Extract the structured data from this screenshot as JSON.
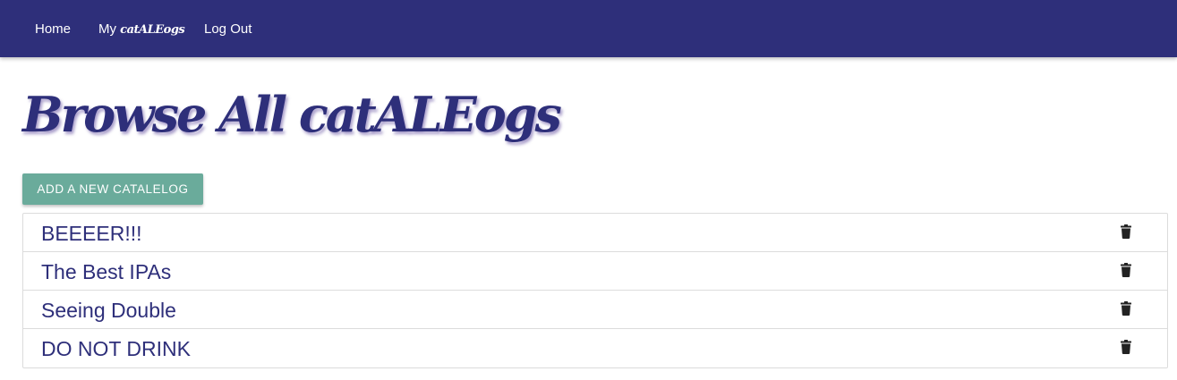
{
  "nav": {
    "home_label": "Home",
    "my_prefix": "My ",
    "my_brand": "catALEogs",
    "logout_label": "Log Out"
  },
  "page": {
    "title": "Browse All catALEogs",
    "add_button_label": "ADD A NEW CATALELOG"
  },
  "catalogs": [
    {
      "title": "BEEEER!!!",
      "action_icon": "trash-icon"
    },
    {
      "title": "The Best IPAs",
      "action_icon": "trash-icon"
    },
    {
      "title": "Seeing Double",
      "action_icon": "trash-icon"
    },
    {
      "title": "DO NOT DRINK",
      "action_icon": "trash-icon"
    }
  ],
  "colors": {
    "navbar": "#2e2f7a",
    "accent_button": "#6aab9b",
    "title_text": "#2e2f7a",
    "icon": "#222222"
  }
}
